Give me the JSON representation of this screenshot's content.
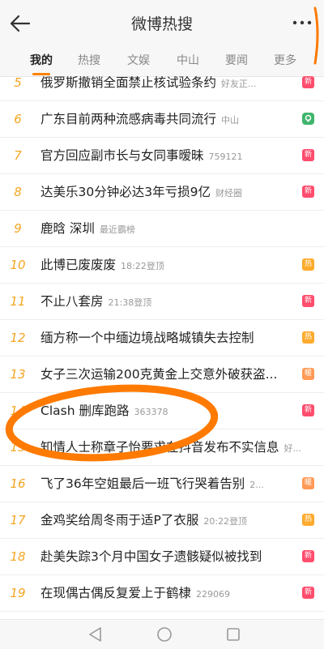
{
  "header": {
    "title": "微博热搜",
    "back_icon": "arrow-left-icon",
    "more_icon": "more-dots-icon"
  },
  "tabs": [
    {
      "label": "我的",
      "active": true
    },
    {
      "label": "热搜"
    },
    {
      "label": "文娱"
    },
    {
      "label": "中山"
    },
    {
      "label": "要闻"
    },
    {
      "label": "更多"
    }
  ],
  "colors": {
    "accent": "#ff8200",
    "rank": "#f5a623",
    "badge_new": "#ff4d6d",
    "badge_hot": "#ffab2e",
    "badge_location": "#3fb56d",
    "annotation": "#ff7a00"
  },
  "items": [
    {
      "rank": "5",
      "title": "俄罗斯撤销全面禁止核试验条约",
      "meta": "好友正...",
      "badge": "新",
      "badge_type": "new"
    },
    {
      "rank": "6",
      "title": "广东目前两种流感病毒共同流行",
      "meta": "中山",
      "badge": "",
      "badge_type": "loc"
    },
    {
      "rank": "7",
      "title": "官方回应副市长与女同事暧昧",
      "meta": "759121",
      "badge": "新",
      "badge_type": "new"
    },
    {
      "rank": "8",
      "title": "达美乐30分钟必达3年亏损9亿",
      "meta": "财经圈",
      "badge": "新",
      "badge_type": "new"
    },
    {
      "rank": "9",
      "title": "鹿晗 深圳",
      "meta": "最近霸榜",
      "badge": "",
      "badge_type": "none"
    },
    {
      "rank": "10",
      "title": "此博已废废废",
      "meta": "18:22登顶",
      "badge": "热",
      "badge_type": "hot"
    },
    {
      "rank": "11",
      "title": "不止八套房",
      "meta": "21:38登顶",
      "badge": "新",
      "badge_type": "new"
    },
    {
      "rank": "12",
      "title": "缅方称一个中缅边境战略城镇失去控制",
      "meta": "",
      "badge": "热",
      "badge_type": "hot"
    },
    {
      "rank": "13",
      "title": "女子三次运输200克黄金上交意外破获盗...",
      "meta": "",
      "badge": "暖",
      "badge_type": "warm"
    },
    {
      "rank": "14",
      "title": "Clash 删库跑路",
      "meta": "363378",
      "badge": "新",
      "badge_type": "new"
    },
    {
      "rank": "15",
      "title": "知情人士称章子怡要求在抖音发布不实信息",
      "meta": "好...",
      "badge": "",
      "badge_type": "none"
    },
    {
      "rank": "16",
      "title": "飞了36年空姐最后一班飞行哭着告别",
      "meta": "2...",
      "badge": "暖",
      "badge_type": "warm"
    },
    {
      "rank": "17",
      "title": "金鸡奖给周冬雨于适P了衣服",
      "meta": "20:22登顶",
      "badge": "热",
      "badge_type": "hot"
    },
    {
      "rank": "18",
      "title": "赴美失踪3个月中国女子遗骸疑似被找到",
      "meta": "",
      "badge": "新",
      "badge_type": "new"
    },
    {
      "rank": "19",
      "title": "在现偶古偶反复爱上于鹤棣",
      "meta": "229069",
      "badge": "新",
      "badge_type": "new"
    }
  ],
  "navbar": {
    "back_icon": "nav-back-triangle-icon",
    "home_icon": "nav-home-circle-icon",
    "recents_icon": "nav-recents-square-icon"
  }
}
